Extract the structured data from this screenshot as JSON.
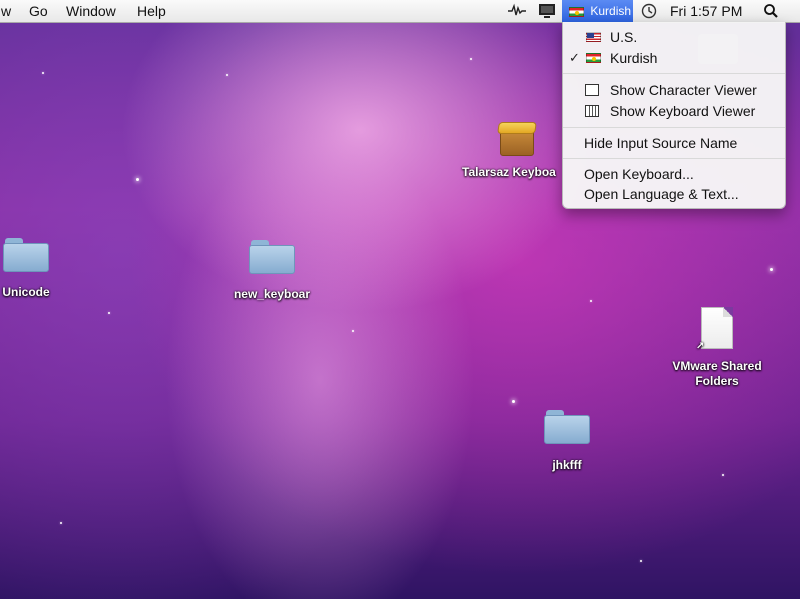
{
  "menubar": {
    "app_menu_partial": "w",
    "menus": [
      "Go",
      "Window",
      "Help"
    ],
    "input_source_label": "Kurdish",
    "clock": "Fri 1:57 PM",
    "icons": [
      "waveform-icon",
      "display-icon",
      "kurdish-flag-icon",
      "time-machine-icon",
      "spotlight-search-icon"
    ]
  },
  "input_menu": {
    "sources": [
      {
        "label": "U.S.",
        "flag": "us-flag-icon",
        "checked": false
      },
      {
        "label": "Kurdish",
        "flag": "kurdish-flag-icon",
        "checked": true
      }
    ],
    "check_mark": "✓",
    "viewers": [
      {
        "label": "Show Character Viewer",
        "icon": "character-viewer-icon"
      },
      {
        "label": "Show Keyboard Viewer",
        "icon": "keyboard-viewer-icon"
      }
    ],
    "hide_name": "Hide Input Source Name",
    "open_items": [
      "Open Keyboard...",
      "Open Language & Text..."
    ]
  },
  "desktop_icons": [
    {
      "label": "Unicode",
      "kind": "folder-icon"
    },
    {
      "label": "new_keyboar",
      "kind": "folder-icon"
    },
    {
      "label": "Talarsaz Keyboa",
      "kind": "package-icon"
    },
    {
      "label": "VMware Shared",
      "label2": "Folders",
      "kind": "document-alias-icon"
    },
    {
      "label": "jhkfff",
      "kind": "folder-icon"
    }
  ],
  "colors": {
    "menu_highlight": "#2e63e0",
    "wallpaper_primary": "#8a2fa5"
  }
}
